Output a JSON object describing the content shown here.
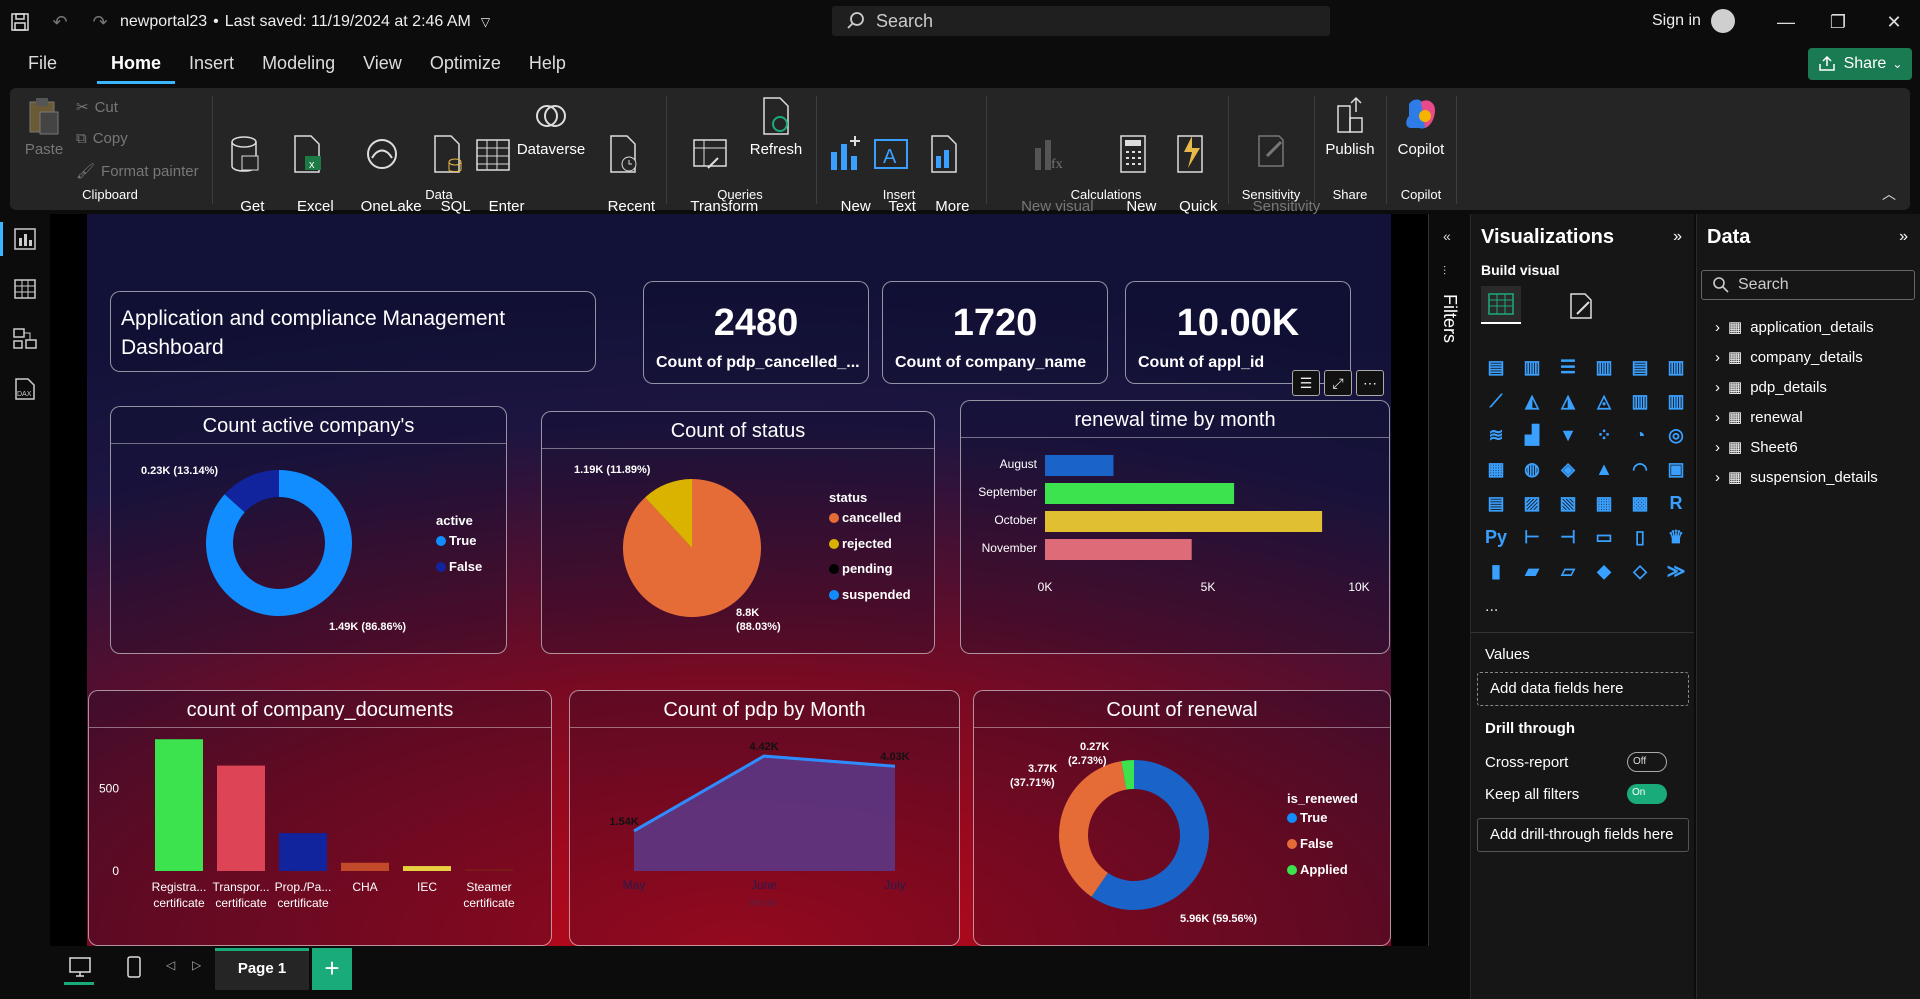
{
  "window": {
    "title": "newportal23",
    "saved": "Last saved: 11/19/2024 at 2:46 AM",
    "search_placeholder": "Search",
    "signin": "Sign in"
  },
  "menu": [
    "File",
    "Home",
    "Insert",
    "Modeling",
    "View",
    "Optimize",
    "Help"
  ],
  "share_label": "Share",
  "ribbon": {
    "clipboard": {
      "paste": "Paste",
      "cut": "Cut",
      "copy": "Copy",
      "format_painter": "Format painter",
      "group": "Clipboard"
    },
    "data": {
      "get_data": "Get\ndata ⌄",
      "excel": "Excel\nworkbook",
      "onelake": "OneLake\ncatalog ⌄",
      "sql": "SQL\nServer",
      "enter": "Enter\ndata",
      "dataverse": "Dataverse",
      "recent": "Recent\nsources ⌄",
      "group": "Data"
    },
    "queries": {
      "transform": "Transform\ndata ⌄",
      "refresh": "Refresh",
      "group": "Queries"
    },
    "insert": {
      "new_visual": "New\nvisual",
      "text_box": "Text\nbox",
      "more_visuals": "More\nvisuals ⌄",
      "group": "Insert"
    },
    "calculations": {
      "new_visual_calc": "New visual\ncalculation ⌄",
      "new_measure": "New\nmeasure",
      "quick_measure": "Quick\nmeasure",
      "group": "Calculations"
    },
    "sensitivity": {
      "label": "Sensitivity\n⌄",
      "group": "Sensitivity"
    },
    "share": {
      "publish": "Publish",
      "group": "Share"
    },
    "copilot": {
      "label": "Copilot",
      "group": "Copilot"
    }
  },
  "dashboard": {
    "title": "Application and compliance  Management Dashboard",
    "kpis": [
      {
        "value": "2480",
        "label": "Count of pdp_cancelled_..."
      },
      {
        "value": "1720",
        "label": "Count of company_name"
      },
      {
        "value": "10.00K",
        "label": "Count of appl_id"
      }
    ],
    "active_chart": {
      "title": "Count active company's",
      "legend_title": "active",
      "legend": [
        {
          "name": "True",
          "color": "#118dff"
        },
        {
          "name": "False",
          "color": "#12239e"
        }
      ],
      "labels": [
        "0.23K (13.14%)",
        "1.49K (86.86%)"
      ]
    },
    "status_chart": {
      "title": "Count of status",
      "legend_title": "status",
      "legend": [
        {
          "name": "cancelled",
          "color": "#e66c37"
        },
        {
          "name": "rejected",
          "color": "#d9b300"
        },
        {
          "name": "pending",
          "color": "#000000"
        },
        {
          "name": "suspended",
          "color": "#118dff"
        }
      ],
      "labels": [
        "1.19K (11.89%)",
        "8.8K",
        "(88.03%)"
      ]
    },
    "renewal_month": {
      "title": "renewal time by month",
      "x_ticks": [
        "0K",
        "5K",
        "10K"
      ]
    },
    "documents": {
      "title": "count of company_documents",
      "y_ticks": [
        "500",
        "0"
      ],
      "x_labels": [
        [
          "Registra...",
          "certificate"
        ],
        [
          "Transpor...",
          "certificate"
        ],
        [
          "Prop./Pa...",
          "certificate"
        ],
        [
          "CHA",
          ""
        ],
        [
          "IEC",
          ""
        ],
        [
          "Steamer",
          "certificate"
        ]
      ]
    },
    "pdp_month": {
      "title": "Count of pdp by Month",
      "labels": [
        "1.54K",
        "4.42K",
        "4.03K"
      ],
      "x_labels": [
        "May",
        "June",
        "July"
      ],
      "xlabel": "Month"
    },
    "renewal_count": {
      "title": "Count of renewal",
      "legend_title": "is_renewed",
      "legend": [
        {
          "name": "True",
          "color": "#118dff"
        },
        {
          "name": "False",
          "color": "#e66c37"
        },
        {
          "name": "Applied",
          "color": "#3ce34f"
        }
      ],
      "labels": [
        "0.27K",
        "(2.73%)",
        "3.77K",
        "(37.71%)",
        "5.96K (59.56%)"
      ]
    }
  },
  "chart_data": [
    {
      "type": "pie",
      "title": "Count active company's",
      "donut": true,
      "categories": [
        "True",
        "False"
      ],
      "values": [
        1490,
        230
      ],
      "percent": [
        86.86,
        13.14
      ]
    },
    {
      "type": "pie",
      "title": "Count of status",
      "categories": [
        "cancelled",
        "rejected",
        "pending",
        "suspended"
      ],
      "values": [
        8800,
        1190,
        0,
        0
      ],
      "percent": [
        88.03,
        11.89,
        0,
        0
      ]
    },
    {
      "type": "bar",
      "orientation": "horizontal",
      "title": "renewal time by month",
      "categories": [
        "August",
        "September",
        "October",
        "November"
      ],
      "values": [
        2100,
        5800,
        8500,
        4500
      ],
      "colors": [
        "#1a63c9",
        "#3ce34f",
        "#e0c030",
        "#dd6b78"
      ],
      "xlim": [
        0,
        10000
      ]
    },
    {
      "type": "bar",
      "title": "count of company_documents",
      "categories": [
        "Registra... certificate",
        "Transpor... certificate",
        "Prop./Pa... certificate",
        "CHA",
        "IEC",
        "Steamer certificate"
      ],
      "values": [
        800,
        640,
        230,
        50,
        30,
        5
      ],
      "colors": [
        "#3ce34f",
        "#dd4455",
        "#12239e",
        "#c24a2a",
        "#e8d040",
        "#7a1a1a"
      ],
      "ylim": [
        0,
        850
      ]
    },
    {
      "type": "area",
      "title": "Count of pdp by Month",
      "categories": [
        "May",
        "June",
        "July"
      ],
      "values": [
        1540,
        4420,
        4030
      ],
      "xlabel": "Month"
    },
    {
      "type": "pie",
      "title": "Count of renewal",
      "donut": true,
      "categories": [
        "True",
        "False",
        "Applied"
      ],
      "values": [
        5960,
        3770,
        270
      ],
      "percent": [
        59.56,
        37.71,
        2.73
      ]
    }
  ],
  "filters_label": "Filters",
  "visualizations": {
    "title": "Visualizations",
    "build_visual": "Build visual",
    "values": "Values",
    "add_fields": "Add data fields here",
    "drill_through": "Drill through",
    "cross_report": "Cross-report",
    "cross_state": "Off",
    "keep_filters": "Keep all filters",
    "keep_state": "On",
    "add_drill": "Add drill-through fields here",
    "more": "..."
  },
  "data_pane": {
    "title": "Data",
    "search": "Search",
    "tables": [
      "application_details",
      "company_details",
      "pdp_details",
      "renewal",
      "Sheet6",
      "suspension_details"
    ]
  },
  "page_tab": "Page 1",
  "add_page": "+"
}
